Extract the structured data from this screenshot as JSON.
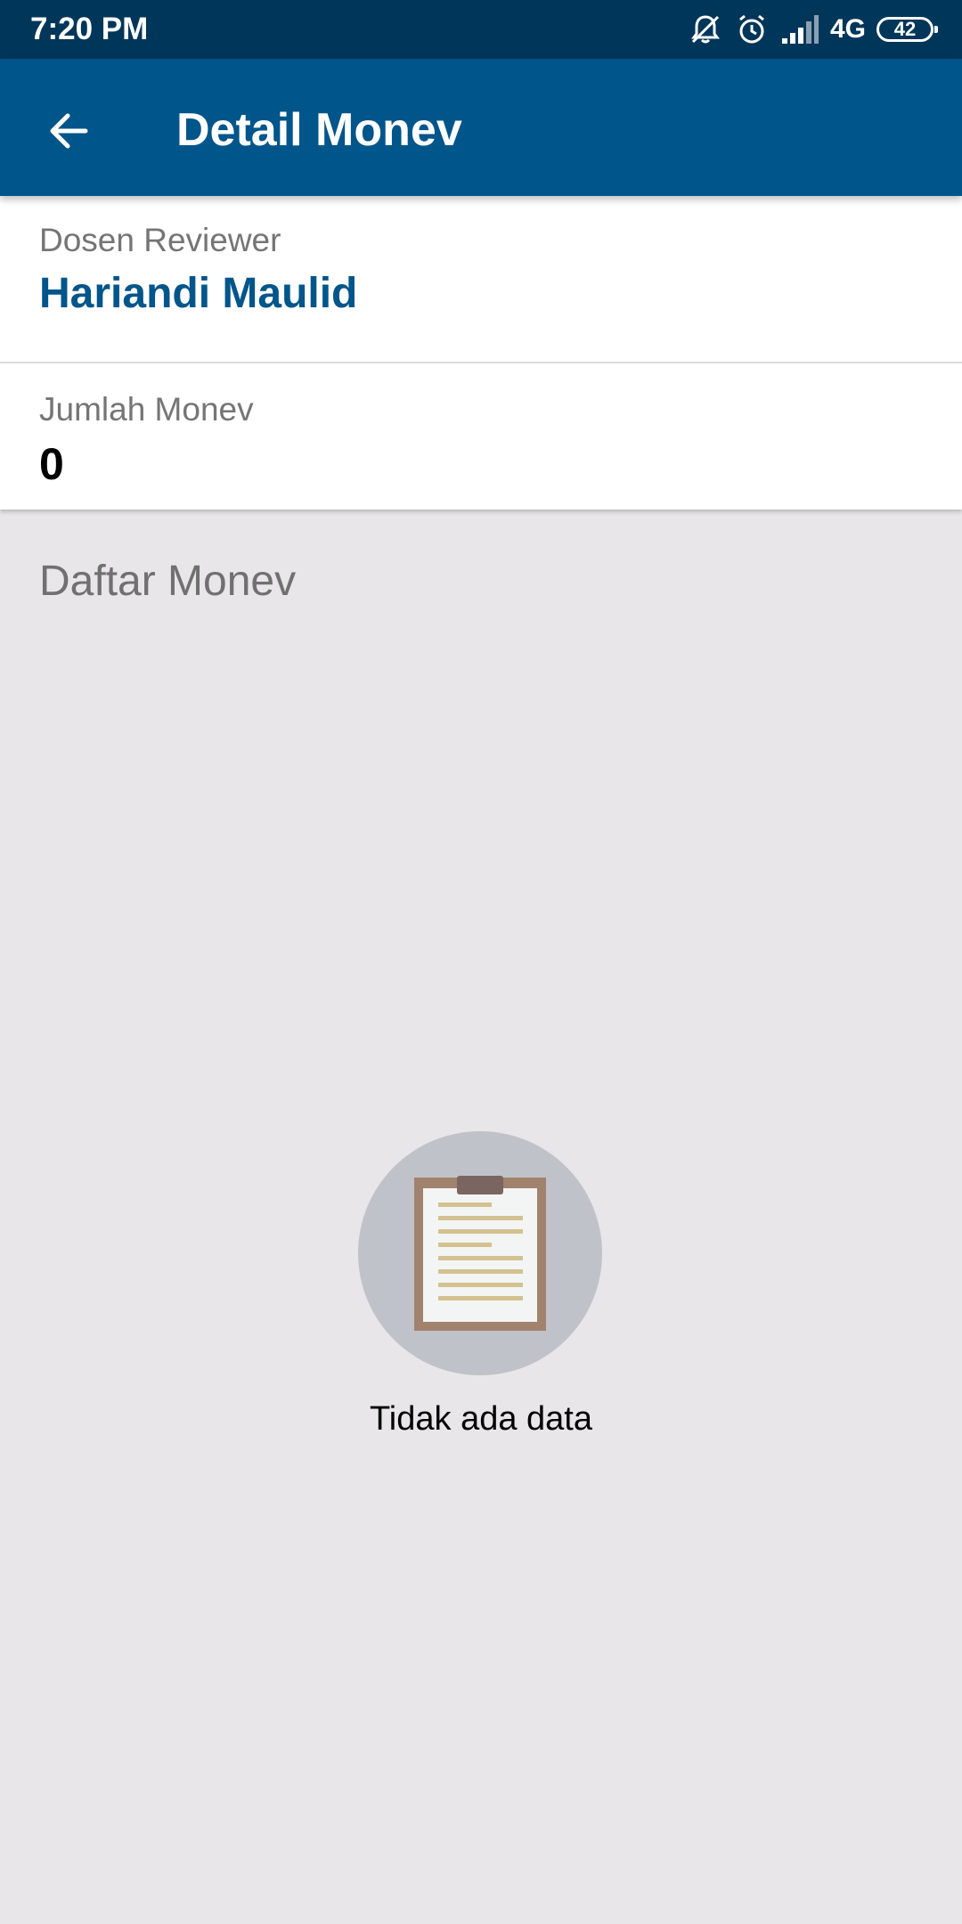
{
  "status_bar": {
    "time": "7:20 PM",
    "network": "4G",
    "battery": "42",
    "icons": [
      "muted-bell-icon",
      "alarm-icon",
      "signal-icon",
      "battery-icon"
    ]
  },
  "app_bar": {
    "title": "Detail Monev",
    "back_icon": "back-arrow-icon"
  },
  "reviewer": {
    "label": "Dosen Reviewer",
    "name": "Hariandi Maulid"
  },
  "jumlah": {
    "label": "Jumlah Monev",
    "value": "0"
  },
  "list": {
    "title": "Daftar Monev",
    "empty_icon": "clipboard-icon",
    "empty_text": "Tidak ada data"
  },
  "colors": {
    "status_bar": "#003659",
    "app_bar": "#00558a",
    "accent_text": "#00558a",
    "background": "#e8e6e8",
    "empty_circle": "#c0c2c9"
  }
}
